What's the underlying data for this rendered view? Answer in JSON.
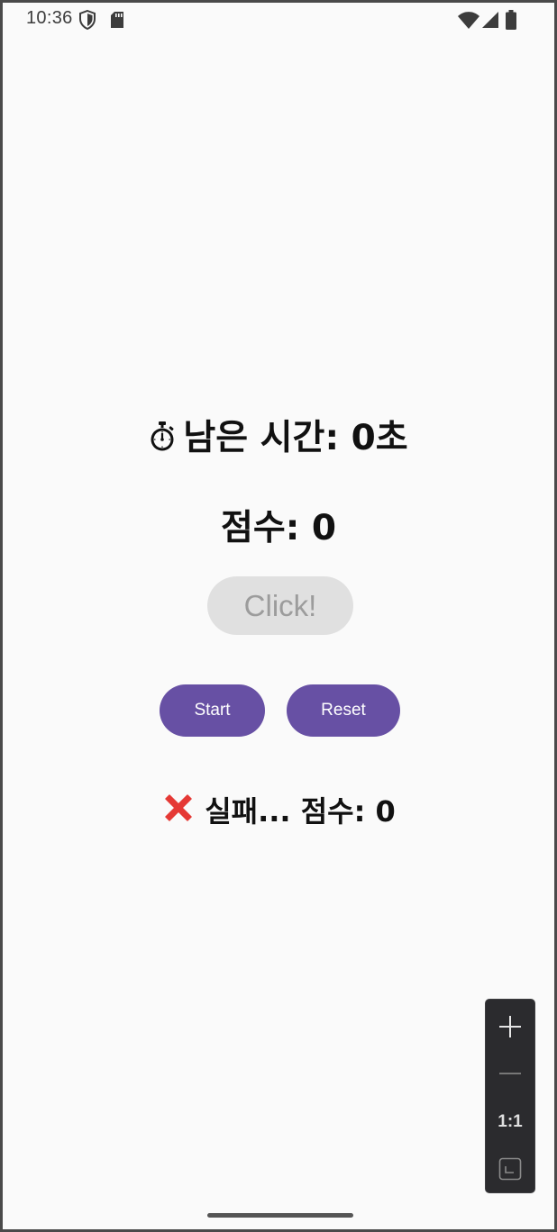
{
  "status_bar": {
    "time": "10:36",
    "icons": [
      "shield-icon",
      "sd-card-icon",
      "wifi-icon",
      "signal-icon",
      "battery-icon"
    ]
  },
  "game": {
    "timer_label": "남은 시간: 0초",
    "timer_icon": "stopwatch-icon",
    "score_label": "점수: 0",
    "click_button_label": "Click!",
    "start_button_label": "Start",
    "reset_button_label": "Reset",
    "result_label": "실패... 점수: 0",
    "result_icon": "cross-mark-icon"
  },
  "zoom_controls": {
    "reset_label": "1:1",
    "icons": [
      "zoom-in-icon",
      "zoom-out-icon",
      "fit-screen-icon"
    ]
  },
  "colors": {
    "background": "#fafafa",
    "primary": "#6750a4",
    "disabled_button": "#e0e0e0",
    "disabled_text": "#9c9c9c",
    "error": "#e53935"
  }
}
